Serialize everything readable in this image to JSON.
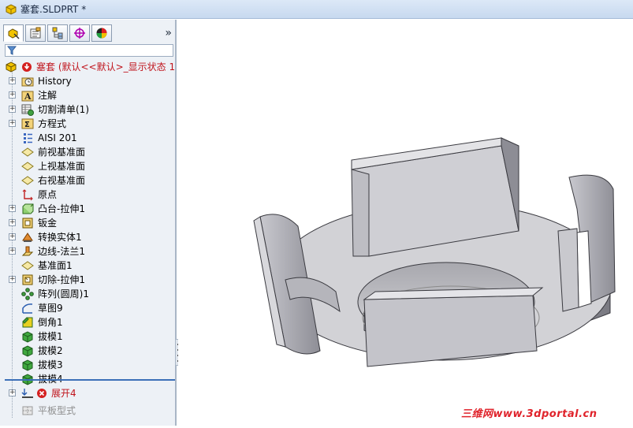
{
  "window": {
    "title": "塞套.SLDPRT *"
  },
  "tabs": {
    "items": [
      "feature-manager",
      "property-manager",
      "configuration-manager",
      "dimxpert-manager",
      "display-manager"
    ],
    "more_label": "»"
  },
  "tree": {
    "root": {
      "label": "塞套  (默认<<默认>_显示状态 1"
    },
    "items": [
      {
        "label": "History",
        "icon": "history-folder-icon",
        "expandable": true
      },
      {
        "label": "注解",
        "icon": "annotations-icon",
        "expandable": true
      },
      {
        "label": "切割清单(1)",
        "icon": "cut-list-icon",
        "expandable": true
      },
      {
        "label": "方程式",
        "icon": "equations-icon",
        "expandable": true
      },
      {
        "label": "AISI 201",
        "icon": "material-icon",
        "expandable": false
      },
      {
        "label": "前视基准面",
        "icon": "plane-icon",
        "expandable": false
      },
      {
        "label": "上视基准面",
        "icon": "plane-icon",
        "expandable": false
      },
      {
        "label": "右视基准面",
        "icon": "plane-icon",
        "expandable": false
      },
      {
        "label": "原点",
        "icon": "origin-icon",
        "expandable": false
      },
      {
        "label": "凸台-拉伸1",
        "icon": "boss-extrude-icon",
        "expandable": true
      },
      {
        "label": "钣金",
        "icon": "sheet-metal-icon",
        "expandable": true
      },
      {
        "label": "转换实体1",
        "icon": "convert-solid-icon",
        "expandable": true
      },
      {
        "label": "边线-法兰1",
        "icon": "edge-flange-icon",
        "expandable": true
      },
      {
        "label": "基准面1",
        "icon": "plane-icon",
        "expandable": false
      },
      {
        "label": "切除-拉伸1",
        "icon": "cut-extrude-icon",
        "expandable": true
      },
      {
        "label": "阵列(圆周)1",
        "icon": "circular-pattern-icon",
        "expandable": false
      },
      {
        "label": "草图9",
        "icon": "sketch-icon",
        "expandable": false
      },
      {
        "label": "倒角1",
        "icon": "chamfer-icon",
        "expandable": false
      },
      {
        "label": "拔模1",
        "icon": "draft-icon",
        "expandable": false
      },
      {
        "label": "拔模2",
        "icon": "draft-icon",
        "expandable": false
      },
      {
        "label": "拔模3",
        "icon": "draft-icon",
        "expandable": false
      },
      {
        "label": "拔模4",
        "icon": "draft-icon",
        "expandable": false
      },
      {
        "label": "展开4",
        "icon": "unfold-error-icon",
        "expandable": true,
        "state": "error"
      },
      {
        "label": "平板型式",
        "icon": "flat-pattern-icon",
        "expandable": false,
        "state": "suppressed"
      }
    ]
  },
  "watermark": "三维网www.3dportal.cn",
  "colors": {
    "error": "#c0141c",
    "accent": "#3c70b8",
    "part": "#d8d8d8"
  }
}
